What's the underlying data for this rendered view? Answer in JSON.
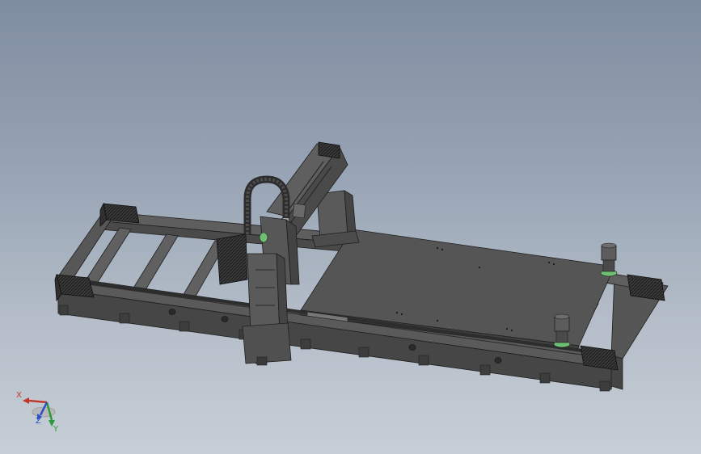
{
  "colors": {
    "background_top": "#7f8da0",
    "background_bottom": "#c7ced7",
    "part_dark": "#4e4e4e",
    "part_mid": "#5b5b5b",
    "part_light": "#6a6a6a",
    "edge": "#1e1e1e",
    "accent_green": "#6fbf73",
    "axis_x": "#c0392b",
    "axis_y": "#2e9b3a",
    "axis_z": "#2a4fc8"
  },
  "triad": {
    "x_label": "X",
    "y_label": "Y",
    "z_label": "Z"
  }
}
